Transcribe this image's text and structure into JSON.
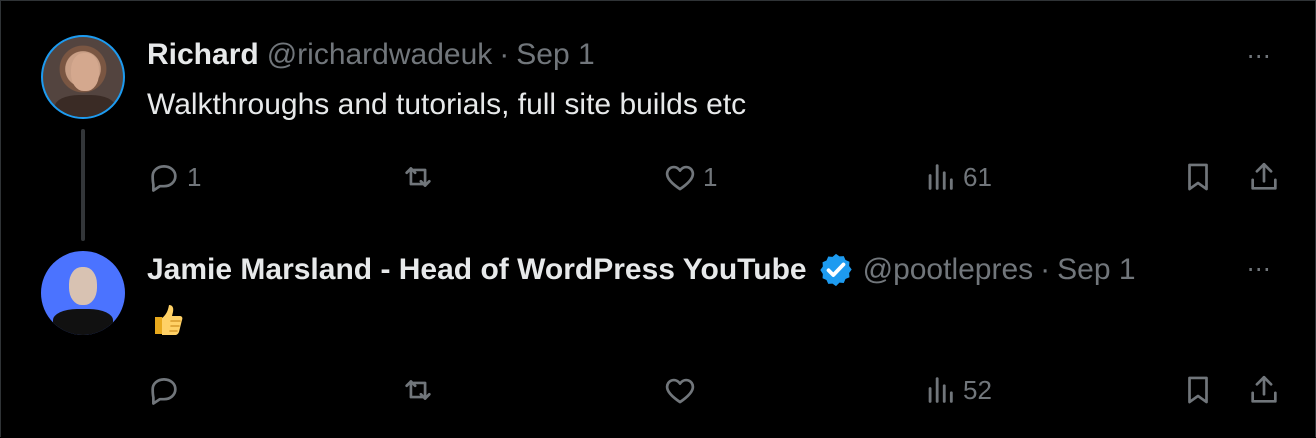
{
  "tweets": [
    {
      "name": "Richard",
      "handle": "@richardwadeuk",
      "separator": "·",
      "date": "Sep 1",
      "text": "Walkthroughs and tutorials, full site builds etc",
      "reply_count": "1",
      "retweet_count": "",
      "like_count": "1",
      "view_count": "61"
    },
    {
      "name": "Jamie Marsland - Head of WordPress YouTube",
      "handle": "@pootlepres",
      "separator": "·",
      "date": "Sep 1",
      "text_emoji": "thumbs-up-emoji",
      "reply_count": "",
      "retweet_count": "",
      "like_count": "",
      "view_count": "52",
      "verified": true
    }
  ],
  "icons": {
    "more": "⋯",
    "reply": "reply-icon",
    "retweet": "retweet-icon",
    "like": "heart-icon",
    "views": "views-icon",
    "bookmark": "bookmark-icon",
    "share": "share-icon"
  },
  "colors": {
    "background": "#000000",
    "text": "#e7e9ea",
    "muted": "#71767b",
    "verified": "#1d9bf0",
    "thread_line": "#333639"
  }
}
